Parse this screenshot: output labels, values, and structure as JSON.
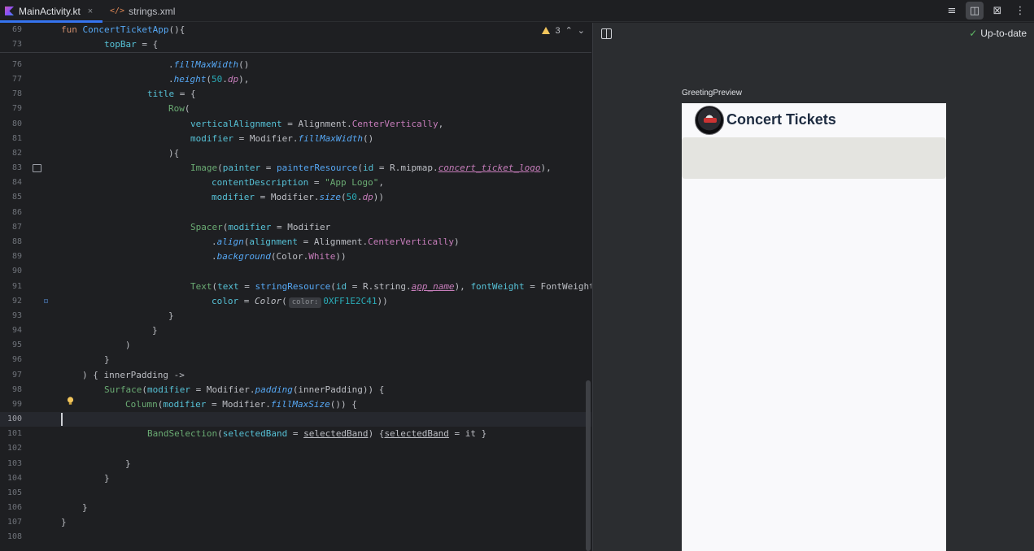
{
  "tabs": [
    {
      "label": "MainActivity.kt",
      "active": true
    },
    {
      "label": "strings.xml",
      "active": false
    }
  ],
  "tab_close_glyph": "×",
  "editor": {
    "warning_count": "3",
    "sticky_lines": [
      {
        "num": "69"
      },
      {
        "num": "73"
      }
    ],
    "lines": [
      {
        "num": "76"
      },
      {
        "num": "77"
      },
      {
        "num": "78"
      },
      {
        "num": "79"
      },
      {
        "num": "80"
      },
      {
        "num": "81"
      },
      {
        "num": "82"
      },
      {
        "num": "83"
      },
      {
        "num": "84"
      },
      {
        "num": "85"
      },
      {
        "num": "86"
      },
      {
        "num": "87"
      },
      {
        "num": "88"
      },
      {
        "num": "89"
      },
      {
        "num": "90"
      },
      {
        "num": "91"
      },
      {
        "num": "92"
      },
      {
        "num": "93"
      },
      {
        "num": "94"
      },
      {
        "num": "95"
      },
      {
        "num": "96"
      },
      {
        "num": "97"
      },
      {
        "num": "98"
      },
      {
        "num": "99"
      },
      {
        "num": "100"
      },
      {
        "num": "101"
      },
      {
        "num": "102"
      },
      {
        "num": "103"
      },
      {
        "num": "104"
      },
      {
        "num": "105"
      },
      {
        "num": "106"
      },
      {
        "num": "107"
      },
      {
        "num": "108"
      }
    ],
    "current_line": "100",
    "code": {
      "l69_a": "fun ",
      "l69_b": "ConcertTicketApp",
      "l69_c": "(){",
      "l73_a": "topBar",
      "l73_b": " = {",
      "l76_a": ".",
      "l76_b": "fillMaxWidth",
      "l76_c": "()",
      "l77_a": ".",
      "l77_b": "height",
      "l77_c": "(",
      "l77_d": "50",
      "l77_e": ".",
      "l77_f": "dp",
      "l77_g": "),",
      "l78_a": "title",
      "l78_b": " = {",
      "l79_a": "Row",
      "l79_b": "(",
      "l80_a": "verticalAlignment",
      "l80_b": " = Alignment.",
      "l80_c": "CenterVertically",
      "l80_d": ",",
      "l81_a": "modifier",
      "l81_b": " = Modifier.",
      "l81_c": "fillMaxWidth",
      "l81_d": "()",
      "l82_a": "){",
      "l83_a": "Image",
      "l83_b": "(",
      "l83_c": "painter",
      "l83_d": " = ",
      "l83_e": "painterResource",
      "l83_f": "(",
      "l83_g": "id",
      "l83_h": " = R.mipmap.",
      "l83_i": "concert_ticket_logo",
      "l83_j": "),",
      "l84_a": "contentDescription",
      "l84_b": " = ",
      "l84_c": "\"App Logo\"",
      "l84_d": ",",
      "l85_a": "modifier",
      "l85_b": " = Modifier.",
      "l85_c": "size",
      "l85_d": "(",
      "l85_e": "50",
      "l85_f": ".",
      "l85_g": "dp",
      "l85_h": "))",
      "l87_a": "Spacer",
      "l87_b": "(",
      "l87_c": "modifier",
      "l87_d": " = Modifier",
      "l88_a": ".",
      "l88_b": "align",
      "l88_c": "(",
      "l88_d": "alignment",
      "l88_e": " = Alignment.",
      "l88_f": "CenterVertically",
      "l88_g": ")",
      "l89_a": ".",
      "l89_b": "background",
      "l89_c": "(Color.",
      "l89_d": "White",
      "l89_e": "))",
      "l91_a": "Text",
      "l91_b": "(",
      "l91_c": "text",
      "l91_d": " = ",
      "l91_e": "stringResource",
      "l91_f": "(",
      "l91_g": "id",
      "l91_h": " = R.string.",
      "l91_i": "app_name",
      "l91_j": "), ",
      "l91_k": "fontWeight",
      "l91_l": " = FontWeight",
      "l92_a": "color",
      "l92_b": " = ",
      "l92_c": "Color",
      "l92_d": "(",
      "l92_hint": "color:",
      "l92_e": "0XFF1E2C41",
      "l92_f": "))",
      "l93_a": "}",
      "l94_a": "}",
      "l95_a": ")",
      "l96_a": "}",
      "l97_a": ") { innerPadding ->",
      "l98_a": "Surface",
      "l98_b": "(",
      "l98_c": "modifier",
      "l98_d": " = Modifier.",
      "l98_e": "padding",
      "l98_f": "(innerPadding)) {",
      "l99_a": "Column",
      "l99_b": "(",
      "l99_c": "modifier",
      "l99_d": " = Modifier.",
      "l99_e": "fillMaxSize",
      "l99_f": "()) {",
      "l101_a": "BandSelection",
      "l101_b": "(",
      "l101_c": "selectedBand",
      "l101_d": " = ",
      "l101_e": "selectedBand",
      "l101_f": ") {",
      "l101_g": "selectedBand",
      "l101_h": " = it }",
      "l103_a": "}",
      "l104_a": "}",
      "l106_a": "}",
      "l107_a": "}"
    }
  },
  "preview": {
    "status": "Up-to-date",
    "label": "GreetingPreview",
    "app_title": "Concert Tickets",
    "title_color": "#1E2C41"
  },
  "colors": {
    "accent": "#3574f0",
    "warning": "#f2c55c",
    "status_ok": "#5fb865"
  }
}
